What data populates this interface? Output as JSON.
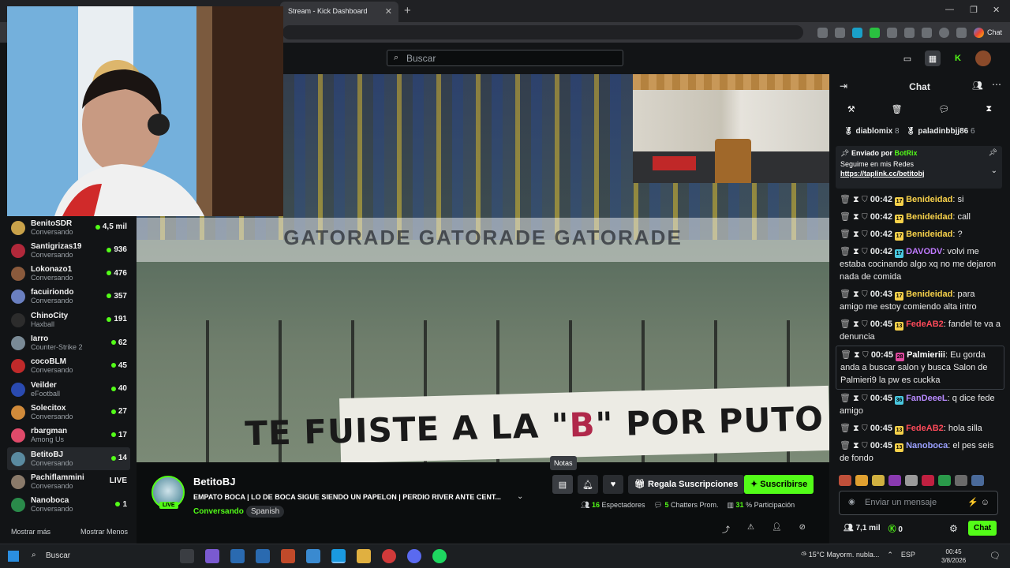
{
  "browser": {
    "tab_title": "Stream - Kick Dashboard",
    "chat_label": "Chat"
  },
  "topbar": {
    "search_placeholder": "Buscar"
  },
  "sidebar": {
    "channels": [
      {
        "name": "BenitoSDR",
        "category": "Conversando",
        "viewers": "4,5 mil",
        "color": "#c9a24a"
      },
      {
        "name": "Santigrizas19",
        "category": "Conversando",
        "viewers": "936",
        "color": "#b1283a"
      },
      {
        "name": "Lokonazo1",
        "category": "Conversando",
        "viewers": "476",
        "color": "#8a5a3c"
      },
      {
        "name": "facuiriondo",
        "category": "Conversando",
        "viewers": "357",
        "color": "#6a7fc0"
      },
      {
        "name": "ChinoCity",
        "category": "Haxball",
        "viewers": "191",
        "color": "#2c2c2c"
      },
      {
        "name": "Iarro",
        "category": "Counter-Strike 2",
        "viewers": "62",
        "color": "#7a8a96"
      },
      {
        "name": "cocoBLM",
        "category": "Conversando",
        "viewers": "45",
        "color": "#c02a2a"
      },
      {
        "name": "Veilder",
        "category": "eFootball",
        "viewers": "40",
        "color": "#2a4ab0"
      },
      {
        "name": "Solecitox",
        "category": "Conversando",
        "viewers": "27",
        "color": "#d08a3a"
      },
      {
        "name": "rbargman",
        "category": "Among Us",
        "viewers": "17",
        "color": "#e04a6a"
      },
      {
        "name": "BetitoBJ",
        "category": "Conversando",
        "viewers": "14",
        "color": "#5a8aa0"
      },
      {
        "name": "Pachiflammini",
        "category": "Conversando",
        "viewers": "LIVE",
        "color": "#8a7a6a"
      },
      {
        "name": "Nanoboca",
        "category": "Conversando",
        "viewers": "1",
        "color": "#2a8a4a"
      }
    ],
    "show_more": "Mostrar más",
    "show_less": "Mostrar Menos"
  },
  "video": {
    "board_text": "GATORADE   GATORADE   GATORADE",
    "banner_pre": "TE FUISTE A LA \"",
    "banner_b": "B",
    "banner_post": "\" POR PUTO Y CA"
  },
  "stream": {
    "channel": "BetitoBJ",
    "live": "LIVE",
    "title": "EMPATO BOCA | LO DE BOCA SIGUE SIENDO UN PAPELON | PERDIO RIVER ANTE CENT...",
    "category": "Conversando",
    "language": "Spanish",
    "tooltip": "Notas",
    "gift_label": "Regala Suscripciones",
    "subscribe_label": "Suscribirse",
    "viewers": "16",
    "viewers_label": "Espectadores",
    "chatters": "5",
    "chatters_label": "Chatters Prom.",
    "participation": "31",
    "participation_label": "% Participación"
  },
  "chat": {
    "title": "Chat",
    "gifters": [
      {
        "name": "diablomix",
        "count": "8"
      },
      {
        "name": "paladinbbjj86",
        "count": "6"
      }
    ],
    "pinned": {
      "header": "Enviado por",
      "bot": "BotRix",
      "line": "Seguime en mis Redes",
      "link": "https://taplink.cc/betitobj"
    },
    "messages": [
      {
        "time": "00:42",
        "badge": "17",
        "badge_color": "#f7d14a",
        "user": "Benideidad",
        "color": "#f7d14a",
        "text": "si"
      },
      {
        "time": "00:42",
        "badge": "17",
        "badge_color": "#f7d14a",
        "user": "Benideidad",
        "color": "#f7d14a",
        "text": "call"
      },
      {
        "time": "00:42",
        "badge": "17",
        "badge_color": "#f7d14a",
        "user": "Benideidad",
        "color": "#f7d14a",
        "text": "?"
      },
      {
        "time": "00:42",
        "badge": "17",
        "badge_color": "#4ac8e0",
        "user": "DAVODV",
        "color": "#c07aff",
        "text": "volvi me estaba cocinando algo xq no me dejaron nada de comida"
      },
      {
        "time": "00:43",
        "badge": "17",
        "badge_color": "#f7d14a",
        "user": "Benideidad",
        "color": "#f7d14a",
        "text": "para amigo me estoy comiendo alta intro"
      },
      {
        "time": "00:45",
        "badge": "13",
        "badge_color": "#f7d14a",
        "user": "FedeAB2",
        "color": "#ff4a5a",
        "text": "fandel te va a denuncia"
      },
      {
        "time": "00:45",
        "badge": "28",
        "badge_color": "#e04aa0",
        "user": "Palmieriii",
        "color": "#ffffff",
        "text": "Eu gorda anda a buscar salon y busca Salon de Palmieri9 la pw es cuckka"
      },
      {
        "time": "00:45",
        "badge": "36",
        "badge_color": "#4ac8e0",
        "user": "FanDeeeL",
        "color": "#b88aff",
        "text": "q dice fede amigo"
      },
      {
        "time": "00:45",
        "badge": "13",
        "badge_color": "#f7d14a",
        "user": "FedeAB2",
        "color": "#ff4a5a",
        "text": "hola silla"
      },
      {
        "time": "00:45",
        "badge": "13",
        "badge_color": "#f7d14a",
        "user": "Nanoboca",
        "color": "#9aa0ff",
        "text": "el pes seis de fondo"
      }
    ],
    "input_placeholder": "Enviar un mensaje",
    "followers": "7,1 mil",
    "kicks": "0",
    "send_label": "Chat"
  },
  "taskbar": {
    "search": "Buscar",
    "temp": "15°C",
    "weather": "Mayorm. nubla...",
    "lang": "ESP",
    "time": "00:45",
    "date": "3/8/2026"
  }
}
